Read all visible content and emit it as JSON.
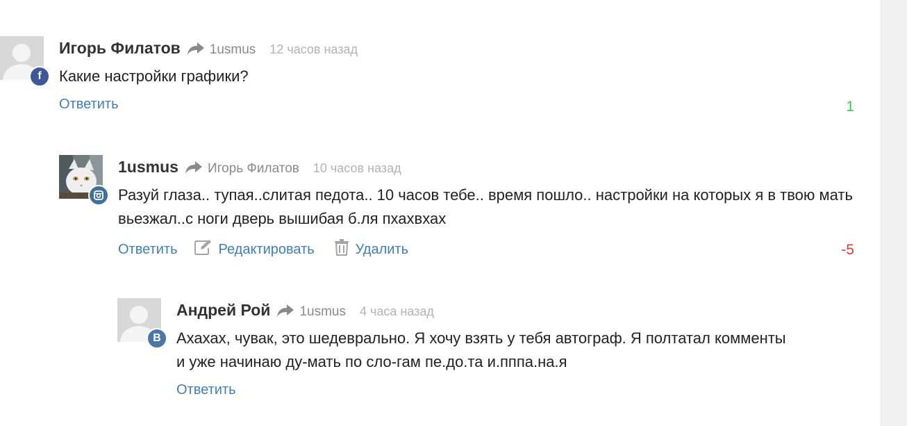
{
  "colors": {
    "link": "#3f7fb8",
    "positive": "#2ecc40",
    "negative": "#e53935",
    "facebook": "#3b5998",
    "instagram": "#3f729b",
    "vk": "#4a76a8",
    "muted": "#8a8a8a"
  },
  "comments": [
    {
      "author": "Игорь Филатов",
      "reply_to": "1usmus",
      "time": "12 часов назад",
      "text": "Какие настройки графики?",
      "network_icon": "facebook-icon",
      "network_letter": "f",
      "actions": {
        "reply": "Ответить"
      },
      "rating": "1",
      "rating_sign": "positive"
    },
    {
      "author": "1usmus",
      "reply_to": "Игорь Филатов",
      "time": "10 часов назад",
      "text": "Разуй глаза.. тупая..слитая педота.. 10 часов тебе.. время пошло.. настройки на которых я в твою мать вьезжал..с ноги дверь вышибая б.ля пхахвхах",
      "network_icon": "instagram-icon",
      "actions": {
        "reply": "Ответить",
        "edit": "Редактировать",
        "delete": "Удалить"
      },
      "rating": "-5",
      "rating_sign": "negative"
    },
    {
      "author": "Андрей Рой",
      "reply_to": "1usmus",
      "time": "4 часа назад",
      "text": "Ахахах, чувак, это шедеврально. Я хочу взять у тебя автограф. Я полтатал комменты и уже начинаю ду-мать по сло-гам пе.до.та и.пппа.на.я",
      "network_icon": "vk-icon",
      "network_letter": "B",
      "actions": {
        "reply": "Ответить"
      }
    }
  ]
}
